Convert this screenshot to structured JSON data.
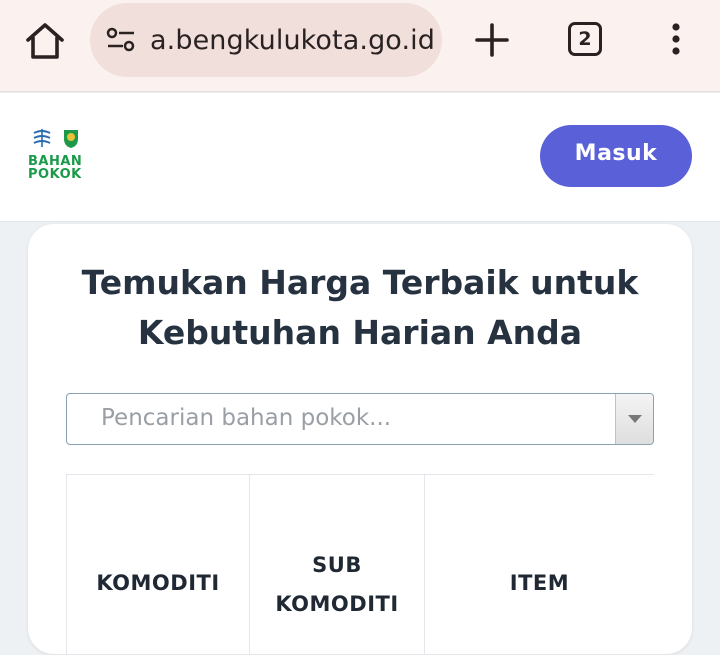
{
  "browser": {
    "url": "a.bengkulukota.go.id",
    "tab_count": "2"
  },
  "site": {
    "logo_line1": "BAHAN",
    "logo_line2": "POKOK",
    "login_label": "Masuk"
  },
  "main": {
    "headline_line1": "Temukan Harga Terbaik untuk",
    "headline_line2": "Kebutuhan Harian Anda",
    "search_placeholder": "Pencarian bahan pokok...",
    "table": {
      "col_komoditi": "KOMODITI",
      "col_sub_line1": "SUB",
      "col_sub_line2": "KOMODITI",
      "col_item": "ITEM"
    }
  },
  "colors": {
    "accent": "#5a61d8",
    "logo_green": "#1c9a4a",
    "browser_bar": "#fbf1ef"
  },
  "icons": [
    "home-icon",
    "site-settings-icon",
    "plus-icon",
    "tabs-icon",
    "more-vert-icon",
    "chevron-down-icon"
  ]
}
